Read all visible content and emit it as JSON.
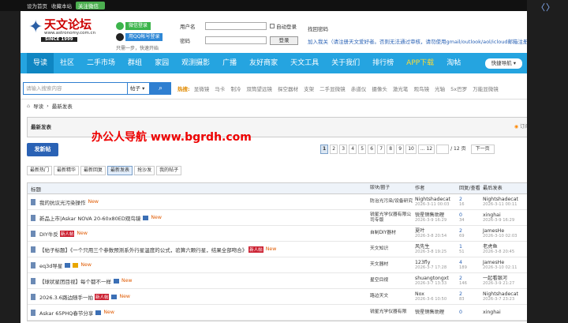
{
  "topbar": {
    "set_home": "设为首页",
    "favorite": "收藏本站",
    "wechat": "关注微信"
  },
  "logo": {
    "brand": "天文论坛",
    "url": "www.astronomy.com.cn",
    "since": "SINCE 1999"
  },
  "slogan": "只需一步，快速开始",
  "quick_login": {
    "wechat": "微信登录",
    "qq": "用QQ帐号登录"
  },
  "login": {
    "username_label": "用户名",
    "password_label": "密码",
    "auto_login": "自动登录",
    "login_button": "登录",
    "find_password": "找回密码",
    "join": "加入我关（请注册天文爱好者。否则无法通过审核，请勿使用gmail/outlook/aol/icloud邮箱注册）"
  },
  "nav": {
    "items": [
      "导读",
      "社区",
      "二手市场",
      "群组",
      "家园",
      "观测摄影",
      "广播",
      "友好商家",
      "天文工具",
      "关于我们",
      "排行榜",
      "APP下载",
      "淘帖"
    ],
    "quick": "快捷导航"
  },
  "search": {
    "placeholder": "请输入搜索内容",
    "type": "帖子",
    "hot_label": "热搜:",
    "hot": [
      "显微镜",
      "马卡",
      "制冷",
      "双筒望远镜",
      "探空器材",
      "支架",
      "二手显微镜",
      "赤道仪",
      "摄像头",
      "激光笔",
      "观鸟镜",
      "光轴",
      "5x巴罗",
      "万能显微镜"
    ]
  },
  "breadcrumb": [
    "导读",
    "最新发表"
  ],
  "forum_header": {
    "title": "最新发表",
    "rss": "订阅"
  },
  "watermark": "办公人导航 www.bgrdh.com",
  "post_button": "发新帖",
  "pager": {
    "pages": [
      "1",
      "2",
      "3",
      "4",
      "5",
      "6",
      "7",
      "8",
      "9",
      "10",
      "... 12"
    ],
    "total": "/ 12 页",
    "next": "下一页"
  },
  "filter_tabs": [
    "最新热门",
    "最新精华",
    "最新回复",
    "最新发表",
    "抢沙发",
    "我的帖子"
  ],
  "table": {
    "headers": [
      "标题",
      "版块/圈子",
      "作者",
      "回复/查看",
      "最后发表"
    ],
    "rows": [
      {
        "title": "我的抗议光污染操作",
        "tag": "",
        "new": "New",
        "forum": "防治光污染/设备研究",
        "author": "Nightshadecat",
        "author_time": "2026-3-11 00:03",
        "replies": "2",
        "views": "16",
        "last": "Nightshadecat",
        "last_time": "2026-3-11 00:11"
      },
      {
        "title": "新品上市|Askar NOVA 20-60x80ED观鸟镜",
        "tag": "",
        "new": "New",
        "forum": "锐星光学仪器有限公司专版",
        "author": "锐星销售助理",
        "author_time": "2026-3-9 16:29",
        "replies": "0",
        "views": "34",
        "last": "xinghai",
        "last_time": "2026-3-9 16:29"
      },
      {
        "title": "DIY牛反",
        "tag": "新人帖",
        "new": "New",
        "forum": "自制DIY器材",
        "author": "夏叶",
        "author_time": "2026-3-8 20:54",
        "replies": "2",
        "views": "69",
        "last": "JamesHe",
        "last_time": "2026-3-10 02:03"
      },
      {
        "title": "【帖子标题】《一个只用三个参数预测系外行星温度的公式，验算六颗行星，结果全部吻合》",
        "tag": "新人帖",
        "new": "New",
        "forum": "天文知识",
        "author": "风先生",
        "author_time": "2026-3-8 19:25",
        "replies": "1",
        "views": "51",
        "last": "老虎鱼",
        "last_time": "2026-3-8 20:45"
      },
      {
        "title": "eq3d导星",
        "tag": "",
        "new": "New",
        "forum": "天文器材",
        "author": "123fly",
        "author_time": "2026-3-7 17:28",
        "replies": "4",
        "views": "189",
        "last": "JamesHe",
        "last_time": "2026-3-10 02:11"
      },
      {
        "title": "【球状星团目视】每个都不一样",
        "tag": "",
        "new": "New",
        "forum": "星空目视",
        "author": "shuangtongxt",
        "author_time": "2026-3-7 13:33",
        "replies": "2",
        "views": "146",
        "last": "一起看银河",
        "last_time": "2026-3-9 21:27"
      },
      {
        "title": "2026.3.6路边随手一拍",
        "tag": "新人帖",
        "new": "New",
        "forum": "路边天文",
        "author": "Nox",
        "author_time": "2026-3-6 10:50",
        "replies": "2",
        "views": "83",
        "last": "Nightshadecat",
        "last_time": "2026-3-7 23:23"
      },
      {
        "title": "Askar 65PHQ春节分享",
        "tag": "",
        "new": "New",
        "forum": "锐星光学仪器有限",
        "author": "锐星销售助理",
        "author_time": "",
        "replies": "0",
        "views": "",
        "last": "xinghai",
        "last_time": ""
      }
    ]
  }
}
